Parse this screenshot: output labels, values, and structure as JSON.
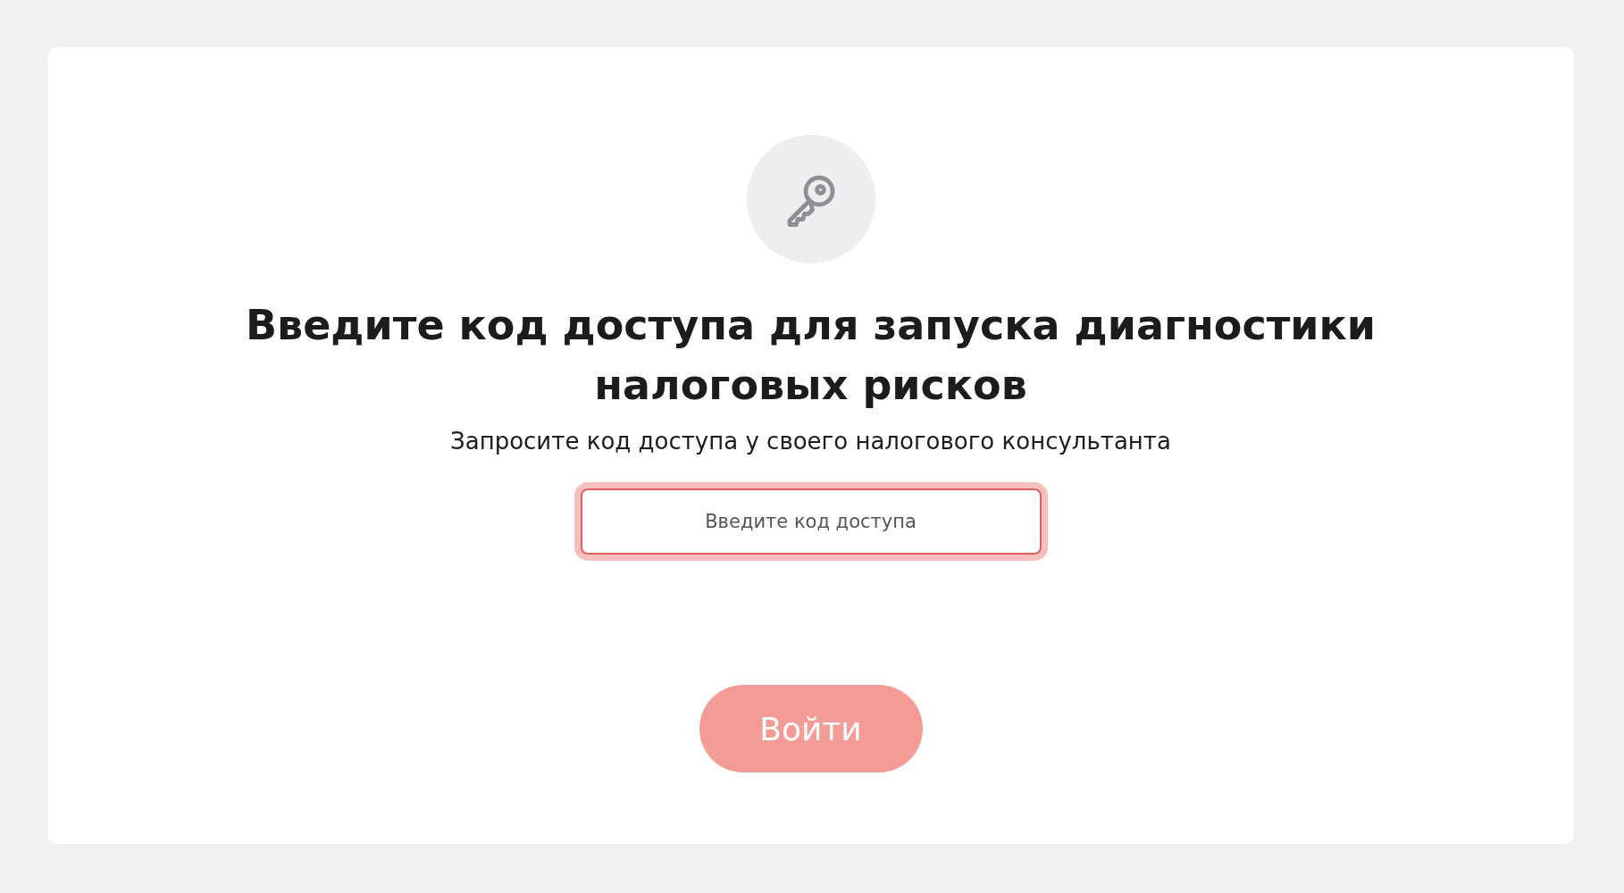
{
  "title": "Введите код доступа для запуска диагностики налоговых рисков",
  "subtitle": "Запросите код доступа у своего налогового консультанта",
  "code_field": {
    "placeholder": "Введите код доступа",
    "focused": true
  },
  "login_button": {
    "label": "Войти",
    "disabled": true
  }
}
